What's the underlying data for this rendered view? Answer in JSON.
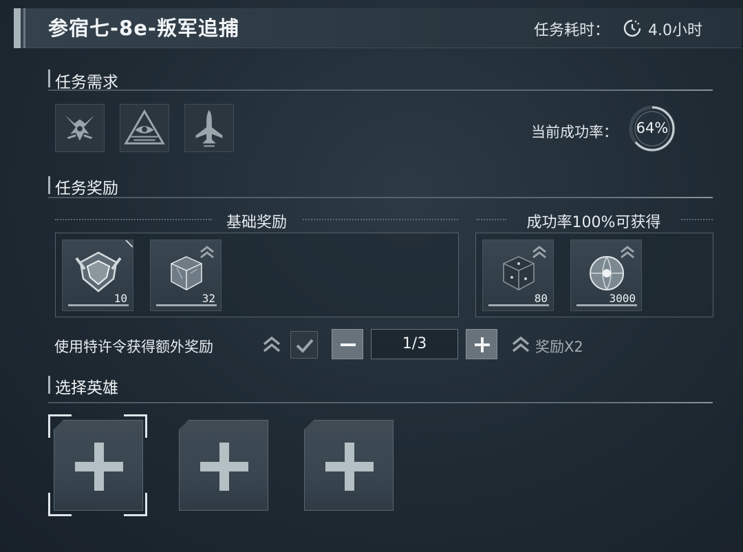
{
  "header": {
    "title": "参宿七-8e-叛军追捕",
    "duration_label": "任务耗时：",
    "duration_value": "4.0小时",
    "duration_icon": "clock-icon"
  },
  "requirements": {
    "title": "任务需求",
    "icons": [
      "insignia-icon",
      "eye-triangle-icon",
      "fighter-jet-icon"
    ],
    "success_rate_label": "当前成功率：",
    "success_rate": "64%",
    "success_rate_fraction": 0.64
  },
  "rewards": {
    "title": "任务奖励",
    "basic": {
      "header": "基础奖励",
      "items": [
        {
          "icon": "rank-badge-icon",
          "qty": "10"
        },
        {
          "icon": "crystal-cube-icon",
          "qty": "32"
        }
      ]
    },
    "bonus": {
      "header": "成功率100%可获得",
      "items": [
        {
          "icon": "dark-cube-icon",
          "qty": "80"
        },
        {
          "icon": "orb-icon",
          "qty": "3000"
        }
      ]
    }
  },
  "permit": {
    "label": "使用特许令获得额外奖励",
    "count": "1/3",
    "reward_label": "奖励X2"
  },
  "heroes": {
    "title": "选择英雄",
    "slots": [
      "add-hero",
      "add-hero",
      "add-hero"
    ]
  },
  "colors": {
    "background": "#1f2a33",
    "accent": "#aab4bb",
    "text": "#e8edf0"
  }
}
